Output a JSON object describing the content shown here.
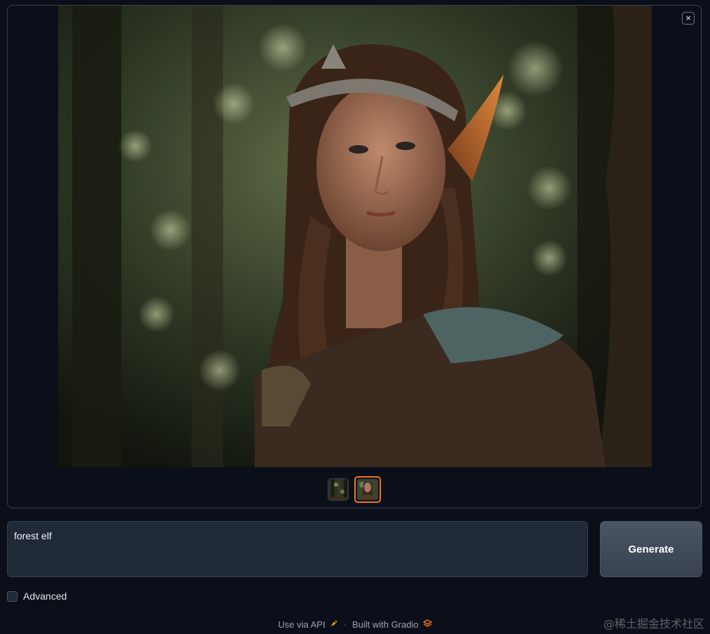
{
  "gallery": {
    "close_icon": "close-icon",
    "close_symbol": "×",
    "main_image": "portrait-elf-in-forest",
    "thumbnails": [
      {
        "name": "forest-thumbnail",
        "selected": false
      },
      {
        "name": "elf-thumbnail",
        "selected": true
      }
    ]
  },
  "prompt": {
    "value": "forest elf"
  },
  "generate": {
    "label": "Generate"
  },
  "advanced": {
    "label": "Advanced",
    "checked": false
  },
  "footer": {
    "api_label": "Use via API",
    "api_icon": "rocket-icon",
    "separator": "·",
    "built_label": "Built with Gradio",
    "gradio_icon": "gradio-logo-icon"
  },
  "watermark": {
    "text": "@稀土掘金技术社区"
  },
  "colors": {
    "background": "#0b0f19",
    "accent_selected": "#f97316",
    "input_bg": "#1f2937",
    "button_bg": "#4b5563"
  }
}
